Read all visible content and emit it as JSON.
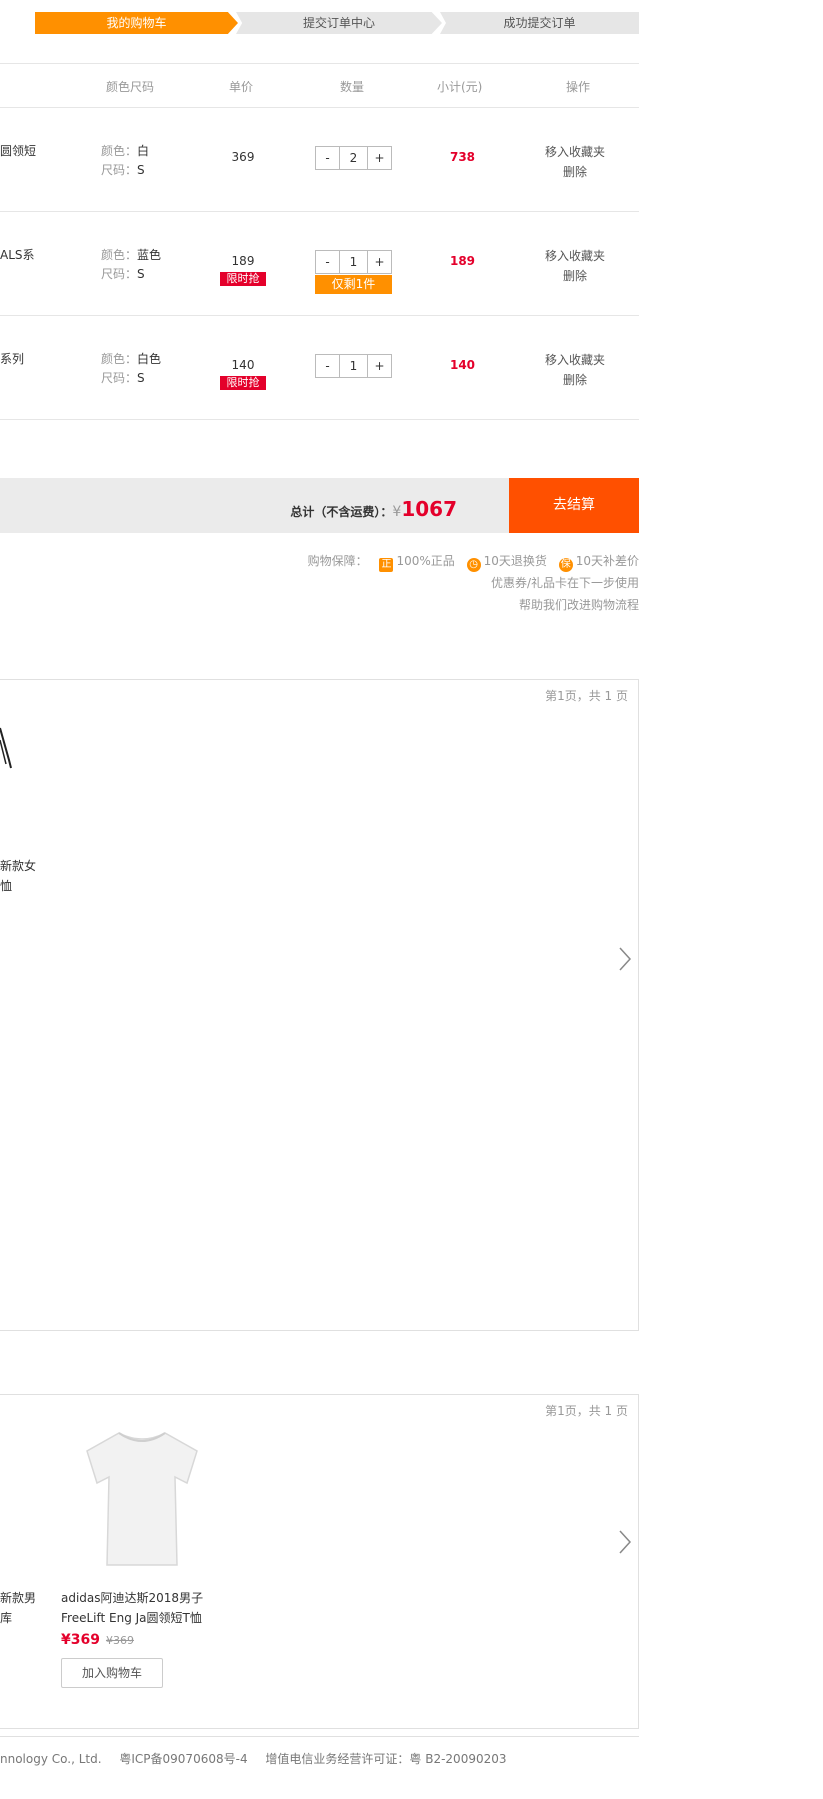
{
  "steps": [
    "我的购物车",
    "提交订单中心",
    "成功提交订单"
  ],
  "table": {
    "headers": {
      "spec": "颜色尺码",
      "price": "单价",
      "qty": "数量",
      "subtotal": "小计(元)",
      "ops": "操作"
    }
  },
  "items": [
    {
      "name": "圆领短",
      "color_label": "颜色：",
      "color": "白",
      "size_label": "尺码：",
      "size": "S",
      "price": "369",
      "flash": "",
      "qty": "2",
      "stock_note": "",
      "subtotal": "738",
      "fav": "移入收藏夹",
      "del": "删除"
    },
    {
      "name": "ALS系",
      "color_label": "颜色：",
      "color": "蓝色",
      "size_label": "尺码：",
      "size": "S",
      "price": "189",
      "flash": "限时抢",
      "qty": "1",
      "stock_note": "仅剩1件",
      "subtotal": "189",
      "fav": "移入收藏夹",
      "del": "删除"
    },
    {
      "name": "系列",
      "color_label": "颜色：",
      "color": "白色",
      "size_label": "尺码：",
      "size": "S",
      "price": "140",
      "flash": "限时抢",
      "qty": "1",
      "stock_note": "",
      "subtotal": "140",
      "fav": "移入收藏夹",
      "del": "删除"
    }
  ],
  "qty_minus": "-",
  "qty_plus": "+",
  "total": {
    "label": "总计（不含运费）：",
    "currency": "¥",
    "amount": "1067",
    "checkout": "去结算"
  },
  "guarantee": {
    "label": "购物保障：",
    "items": [
      {
        "icon": "正",
        "text": "100%正品"
      },
      {
        "icon": "◷",
        "text": "10天退换货"
      },
      {
        "icon": "保",
        "text": "10天补差价"
      }
    ],
    "coupon_note": "优惠券/礼品卡在下一步使用",
    "improve": "帮助我们改进购物流程"
  },
  "panel1": {
    "pager": "第1页，共 1 页",
    "partial_name_1": "新款女",
    "partial_name_2": "恤"
  },
  "panel2": {
    "pager": "第1页，共 1 页",
    "partial_name_1": "新款男",
    "partial_name_2": "库",
    "product": {
      "name_1": "adidas阿迪达斯2018男子",
      "name_2": "FreeLift Eng Ja圆领短T恤",
      "price": "¥369",
      "old_price": "¥369",
      "add": "加入购物车"
    }
  },
  "footer": {
    "company": "nnology Co., Ltd.",
    "icp": "粤ICP备09070608号-4",
    "license": "增值电信业务经营许可证：粤 B2-20090203"
  },
  "colors": {
    "accent": "#ff9000",
    "checkout": "#ff5000",
    "price_red": "#e4002b"
  }
}
